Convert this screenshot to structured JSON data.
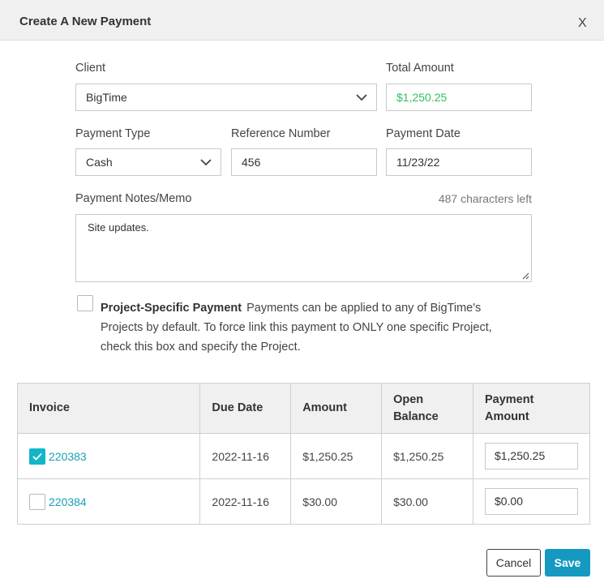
{
  "modal": {
    "title": "Create A New Payment",
    "close_label": "X"
  },
  "form": {
    "client_label": "Client",
    "client_value": "BigTime",
    "total_amount_label": "Total Amount",
    "total_amount_value": "$1,250.25",
    "payment_type_label": "Payment Type",
    "payment_type_value": "Cash",
    "reference_number_label": "Reference Number",
    "reference_number_value": "456",
    "payment_date_label": "Payment Date",
    "payment_date_value": "11/23/22",
    "notes_label": "Payment Notes/Memo",
    "characters_left": "487 characters left",
    "notes_value": "Site updates.",
    "project_specific_checked": false,
    "project_specific_title": "Project-Specific Payment",
    "project_specific_text": "Payments can be applied to any of BigTime's Projects by default. To force link this payment to ONLY one specific Project, check this box and specify the Project."
  },
  "table": {
    "headers": [
      "Invoice",
      "Due Date",
      "Amount",
      "Open Balance",
      "Payment Amount"
    ],
    "rows": [
      {
        "checked": true,
        "invoice": "220383",
        "due_date": "2022-11-16",
        "amount": "$1,250.25",
        "open_balance": "$1,250.25",
        "payment_amount": "$1,250.25"
      },
      {
        "checked": false,
        "invoice": "220384",
        "due_date": "2022-11-16",
        "amount": "$30.00",
        "open_balance": "$30.00",
        "payment_amount": "$0.00"
      }
    ]
  },
  "buttons": {
    "cancel": "Cancel",
    "save": "Save"
  },
  "colors": {
    "accent": "#1599c1",
    "checkbox_checked": "#12b6c8",
    "link": "#1aa0b5",
    "amount_green": "#2fbf5f"
  },
  "icons": [
    "close-icon",
    "chevron-down-icon",
    "checkmark-icon",
    "resize-handle-icon"
  ]
}
